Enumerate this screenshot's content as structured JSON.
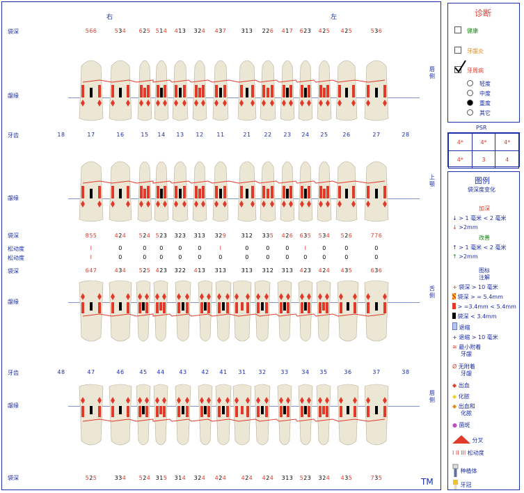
{
  "header": {
    "right_label": "右",
    "left_label": "左"
  },
  "labels": {
    "pocket_depth": "袋深",
    "gingival_margin": "龈缘",
    "teeth": "牙齿",
    "mobility": "松动度",
    "buccal": "唇侧",
    "palatal": "上颚",
    "lingual": "舌侧",
    "tm": "TM"
  },
  "upper_teeth": [
    "18",
    "17",
    "16",
    "15",
    "14",
    "13",
    "12",
    "11",
    "21",
    "22",
    "23",
    "24",
    "25",
    "26",
    "27",
    "28"
  ],
  "lower_teeth": [
    "48",
    "47",
    "46",
    "45",
    "44",
    "43",
    "42",
    "41",
    "31",
    "32",
    "33",
    "34",
    "35",
    "36",
    "37",
    "38"
  ],
  "upper_buccal_depths": [
    "",
    "566",
    "534",
    "625",
    "514",
    "413",
    "324",
    "437",
    "313",
    "226",
    "417",
    "623",
    "425",
    "425",
    "536",
    ""
  ],
  "upper_palatal_depths": [
    "",
    "855",
    "424",
    "524",
    "523",
    "323",
    "313",
    "329",
    "312",
    "335",
    "426",
    "635",
    "534",
    "526",
    "776",
    ""
  ],
  "upper_mobility": [
    "",
    "I",
    "0",
    "0",
    "0",
    "0",
    "0",
    "I",
    "0",
    "0",
    "0",
    "I",
    "0",
    "0",
    "0",
    ""
  ],
  "lower_mobility": [
    "",
    "I",
    "0",
    "0",
    "0",
    "0",
    "0",
    "0",
    "0",
    "0",
    "0",
    "0",
    "0",
    "0",
    "0",
    ""
  ],
  "lower_lingual_depths": [
    "",
    "647",
    "434",
    "525",
    "423",
    "322",
    "413",
    "313",
    "313",
    "312",
    "313",
    "423",
    "424",
    "435",
    "636",
    ""
  ],
  "lower_buccal_depths": [
    "",
    "525",
    "334",
    "524",
    "315",
    "314",
    "324",
    "424",
    "424",
    "424",
    "313",
    "523",
    "324",
    "435",
    "735",
    ""
  ],
  "diagnosis": {
    "title": "诊断",
    "healthy": "健康",
    "gingivitis": "牙龈炎",
    "periodontitis": "牙周病",
    "mild": "轻度",
    "moderate": "中度",
    "severe": "重度",
    "other": "其它",
    "selected_severity": "重度"
  },
  "psr": {
    "title": "PSR",
    "row1": [
      "4*",
      "4*",
      "4*"
    ],
    "row2": [
      "4*",
      "3",
      "4"
    ]
  },
  "legend": {
    "title": "图例",
    "subtitle": "袋深度变化",
    "deepen": "加深",
    "deepen_1": "> 1 毫米 < 2 毫米",
    "deepen_2": ">2mm",
    "improve": "改善",
    "improve_1": "> 1 毫米 < 2 毫米",
    "improve_2": ">2mm",
    "icons_title_1": "图标",
    "icons_title_2": "注解",
    "pd_gt10": "袋深 > 10 毫米",
    "pd_ge54": "袋深 > = 5.4mm",
    "pd_34_54": "> =3.4mm < 5.4mm",
    "pd_lt34": "袋深 < 3.4mm",
    "recession": "退缩",
    "recession_gt10": "退缩 > 10 毫米",
    "min_attached_1": "最小附着",
    "min_attached_2": "牙龈",
    "no_attached_1": "无附着",
    "no_attached_2": "牙龈",
    "bleeding": "出血",
    "suppuration": "化脓",
    "bleed_supp_1": "出血和",
    "bleed_supp_2": "化脓",
    "plaque": "菌斑",
    "furcation": "分叉",
    "mobility_symbols": "I  II  III",
    "mobility": "松动度",
    "implant": "种植体",
    "crown": "牙冠"
  },
  "colors": {
    "blue": "#1a2ca8",
    "red": "#e23a2a",
    "green": "#1a8a1a",
    "orange": "#e08a18"
  }
}
